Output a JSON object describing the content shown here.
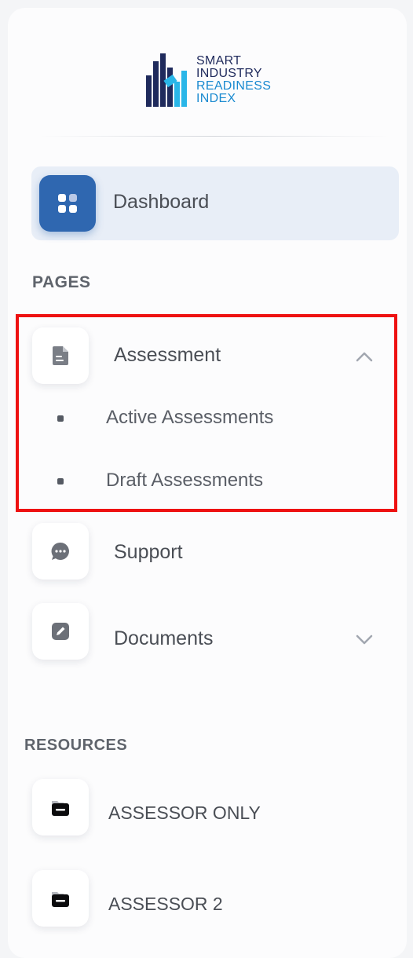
{
  "brand": {
    "line1": "SMART",
    "line2": "INDUSTRY",
    "line3": "READINESS",
    "line4": "INDEX",
    "colors": {
      "dark": "#1f2a5c",
      "blue": "#1a8ad0",
      "cyan": "#29b6e8"
    }
  },
  "nav": {
    "dashboard": {
      "label": "Dashboard",
      "icon": "grid-icon",
      "active": true
    }
  },
  "pages_section": {
    "title": "PAGES",
    "assessment": {
      "label": "Assessment",
      "icon": "document-icon",
      "expanded": true,
      "children": [
        {
          "label": "Active Assessments"
        },
        {
          "label": "Draft Assessments"
        }
      ]
    },
    "support": {
      "label": "Support",
      "icon": "chat-bubble-icon"
    },
    "documents": {
      "label": "Documents",
      "icon": "edit-icon",
      "expanded": false
    }
  },
  "resources_section": {
    "title": "RESOURCES",
    "items": [
      {
        "label": "ASSESSOR ONLY",
        "icon": "folder-icon"
      },
      {
        "label": "ASSESSOR 2",
        "icon": "folder-icon"
      }
    ]
  },
  "colors": {
    "accent": "#2f67b0",
    "active_bg": "#e8eef7",
    "highlight_border": "#ee1111"
  }
}
